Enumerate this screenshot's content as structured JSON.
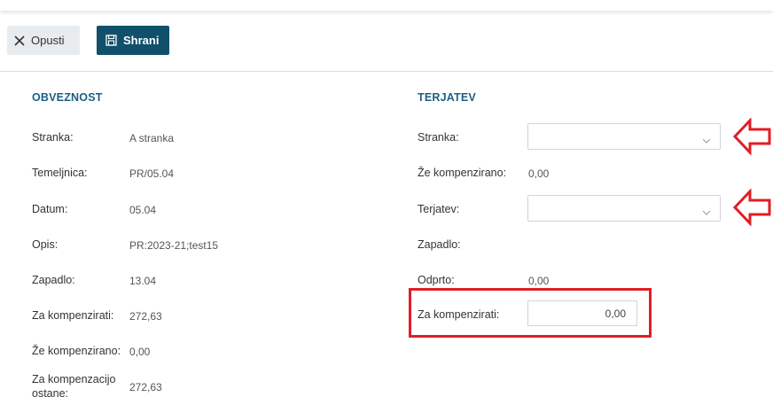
{
  "toolbar": {
    "cancel_label": "Opusti",
    "save_label": "Shrani"
  },
  "obveznost": {
    "title": "OBVEZNOST",
    "rows": [
      {
        "label": "Stranka:",
        "value": "A stranka"
      },
      {
        "label": "Temeljnica:",
        "value": "PR/05.04"
      },
      {
        "label": "Datum:",
        "value": "05.04"
      },
      {
        "label": "Opis:",
        "value": "PR:2023-21;test15"
      },
      {
        "label": "Zapadlo:",
        "value": "13.04"
      },
      {
        "label": "Za kompenzirati:",
        "value": "272,63"
      },
      {
        "label": "Že kompenzirano:",
        "value": "0,00"
      },
      {
        "label": "Za kompenzacijo ostane:",
        "value": "272,63"
      }
    ]
  },
  "terjatev": {
    "title": "TERJATEV",
    "stranka_label": "Stranka:",
    "stranka_value": "",
    "ze_kompenzirano_label": "Že kompenzirano:",
    "ze_kompenzirano_value": "0,00",
    "terjatev_label": "Terjatev:",
    "terjatev_value": "",
    "zapadlo_label": "Zapadlo:",
    "odprto_label": "Odprto:",
    "odprto_value": "0,00",
    "za_kompenzirati_label": "Za kompenzirati:",
    "za_kompenzirati_value": "0,00"
  },
  "colors": {
    "accent": "#10506b",
    "section_title": "#1b5f86",
    "highlight": "#e01e25"
  },
  "icons": {
    "cancel": "close-icon",
    "save": "save-icon",
    "dropdown": "chevron-down-icon",
    "annotation": "arrow-left-icon"
  }
}
